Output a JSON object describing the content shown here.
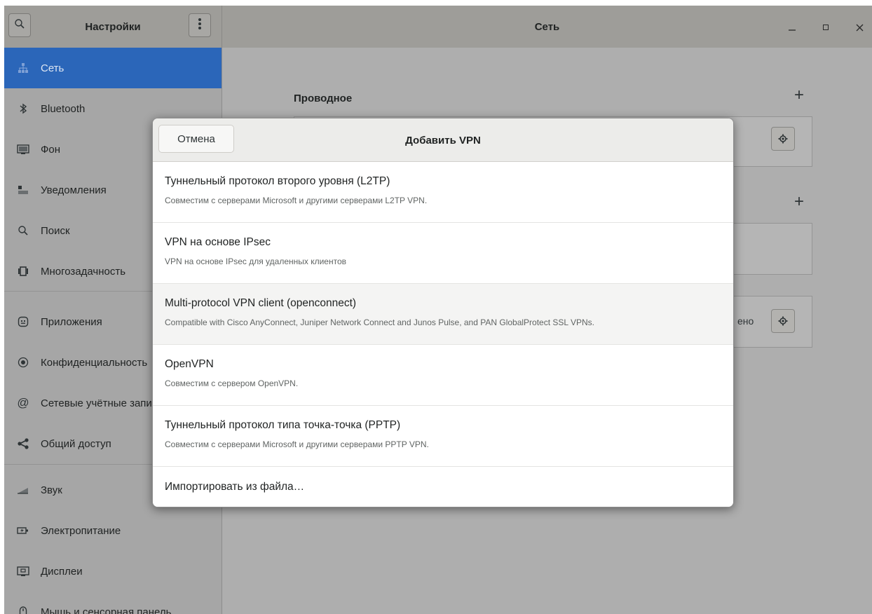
{
  "window": {
    "sidebar_title": "Настройки",
    "page_title": "Сеть"
  },
  "sidebar": {
    "items": [
      {
        "label": "Сеть",
        "icon": "network-icon"
      },
      {
        "label": "Bluetooth",
        "icon": "bluetooth-icon"
      },
      {
        "label": "Фон",
        "icon": "background-icon"
      },
      {
        "label": "Уведомления",
        "icon": "notifications-icon"
      },
      {
        "label": "Поиск",
        "icon": "search-icon"
      },
      {
        "label": "Многозадачность",
        "icon": "multitasking-icon"
      },
      {
        "label": "Приложения",
        "icon": "apps-icon"
      },
      {
        "label": "Конфиденциальность",
        "icon": "privacy-icon"
      },
      {
        "label": "Сетевые учётные записи",
        "icon": "online-accounts-icon"
      },
      {
        "label": "Общий доступ",
        "icon": "sharing-icon"
      },
      {
        "label": "Звук",
        "icon": "sound-icon"
      },
      {
        "label": "Электропитание",
        "icon": "power-icon"
      },
      {
        "label": "Дисплеи",
        "icon": "displays-icon"
      },
      {
        "label": "Мышь и сенсорная панель",
        "icon": "mouse-icon"
      }
    ]
  },
  "main": {
    "wired_title": "Проводное",
    "vpn_status_fragment": "ено"
  },
  "dialog": {
    "cancel_label": "Отмена",
    "title": "Добавить VPN",
    "options": [
      {
        "title": "Туннельный протокол второго уровня (L2TP)",
        "subtitle": "Совместим с серверами Microsoft и другими серверами L2TP VPN."
      },
      {
        "title": "VPN на основе IPsec",
        "subtitle": "VPN на основе IPsec для удаленных клиентов"
      },
      {
        "title": "Multi-protocol VPN client (openconnect)",
        "subtitle": "Compatible with Cisco AnyConnect, Juniper Network Connect and Junos Pulse, and PAN GlobalProtect SSL VPNs."
      },
      {
        "title": "OpenVPN",
        "subtitle": "Совместим с сервером OpenVPN."
      },
      {
        "title": "Туннельный протокол типа точка-точка (PPTP)",
        "subtitle": "Совместим с серверами Microsoft и другими серверами PPTP VPN."
      }
    ],
    "import_label": "Импортировать из файла…"
  },
  "colors": {
    "accent": "#2b66b9",
    "overlay_bg": "#aeaeae",
    "dialog_bg": "#ffffff"
  }
}
